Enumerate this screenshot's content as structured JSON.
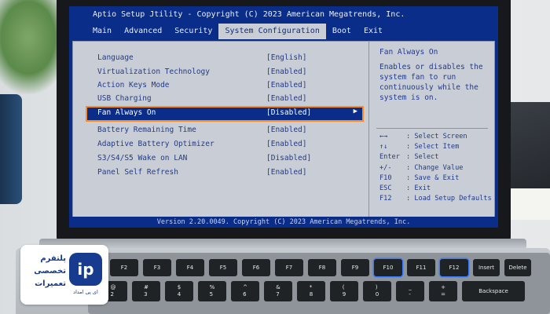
{
  "bios": {
    "title": "Aptio Setup Jtility - Copyright (C) 2023 American Megatrends, Inc.",
    "tabs": [
      "Main",
      "Advanced",
      "Security",
      "System Configuration",
      "Boot",
      "Exit"
    ],
    "active_tab": "System Configuration",
    "rows": [
      {
        "label": "Language",
        "value": "[English]"
      },
      {
        "label": "Virtualization Technology",
        "value": "[Enabled]"
      },
      {
        "label": "Action Keys Mode",
        "value": "[Enabled]"
      },
      {
        "label": "USB Charging",
        "value": "[Enabled]"
      },
      {
        "label": "Fan Always On",
        "value": "[Disabled]",
        "selected": true
      },
      {
        "label": "Battery Remaining Time",
        "value": "[Enabled]"
      },
      {
        "label": "Adaptive Battery Optimizer",
        "value": "[Enabled]"
      },
      {
        "label": "S3/S4/S5 Wake on LAN",
        "value": "[Disabled]"
      },
      {
        "label": "Panel Self Refresh",
        "value": "[Enabled]"
      }
    ],
    "help": {
      "title": "Fan Always On",
      "text": "Enables or disables the system fan to run continuously while the system is on."
    },
    "keys": [
      {
        "key": "←→",
        "desc": ": Select Screen"
      },
      {
        "key": "↑↓",
        "desc": ": Select Item"
      },
      {
        "key": "Enter",
        "desc": ": Select"
      },
      {
        "key": "+/-",
        "desc": ": Change Value"
      },
      {
        "key": "F10",
        "desc": ": Save & Exit"
      },
      {
        "key": "ESC",
        "desc": ": Exit"
      },
      {
        "key": "F12",
        "desc": ": Load Setup Defaults"
      }
    ],
    "footer": "Version 2.20.0049. Copyright (C) 2023 American Megatrends, Inc."
  },
  "keyboard": {
    "fn_row": [
      "F2",
      "F3",
      "F4",
      "F5",
      "F6",
      "F7",
      "F8",
      "F9",
      "F10",
      "F11",
      "F12",
      "Insert",
      "Delete"
    ],
    "num_row": [
      "@\n2",
      "#\n3",
      "$\n4",
      "%\n5",
      "^\n6",
      "&\n7",
      "*\n8",
      "(\n9",
      ")\n0",
      "_\n-",
      "+\n=",
      "Backspace"
    ]
  },
  "logo": {
    "text": "پلتفرم تخصصی تعمیرات",
    "mark": "ip",
    "mark_label": "ای پی امداد"
  },
  "colors": {
    "bios_blue": "#0a2d8a",
    "panel_gray": "#c9ced6",
    "highlight_orange": "#ff8a1f",
    "text_blue": "#223a8a"
  }
}
